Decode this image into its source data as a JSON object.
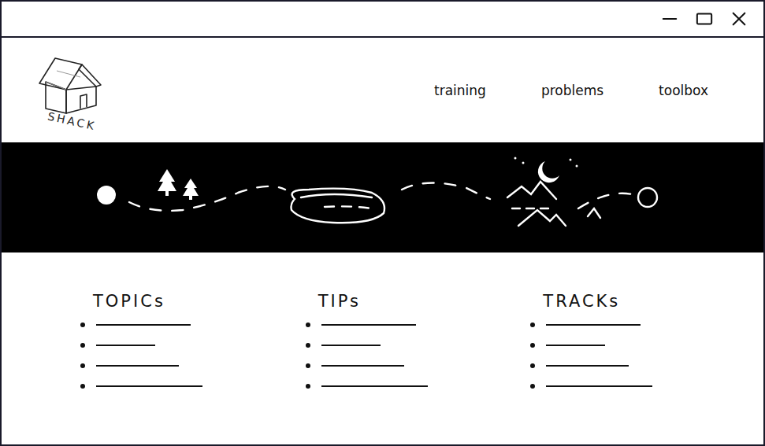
{
  "logo": {
    "text": "SHACK"
  },
  "nav": [
    "training",
    "problems",
    "toolbox"
  ],
  "sections": [
    {
      "title": "TOPICs",
      "items": [
        {
          "kind": "placeholder"
        },
        {
          "kind": "placeholder"
        },
        {
          "kind": "placeholder"
        },
        {
          "kind": "placeholder"
        }
      ]
    },
    {
      "title": "TIPs",
      "items": [
        {
          "kind": "placeholder"
        },
        {
          "kind": "placeholder"
        },
        {
          "kind": "placeholder"
        },
        {
          "kind": "placeholder"
        }
      ]
    },
    {
      "title": "TRACKs",
      "items": [
        {
          "kind": "placeholder"
        },
        {
          "kind": "placeholder"
        },
        {
          "kind": "placeholder"
        },
        {
          "kind": "placeholder"
        }
      ]
    }
  ]
}
